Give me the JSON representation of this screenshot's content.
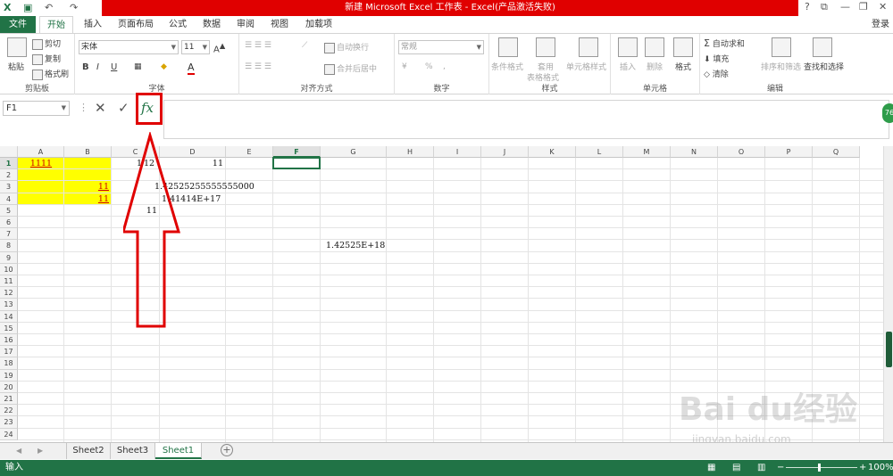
{
  "titlebar": {
    "title": "新建 Microsoft Excel 工作表 - Excel(产品激活失败)",
    "help": "?",
    "restore_ribbon": "⧉",
    "minimize": "—",
    "maximize": "❐",
    "close": "✕",
    "login": "登录"
  },
  "tabs": {
    "file": "文件",
    "home": "开始",
    "insert": "插入",
    "layout": "页面布局",
    "formulas": "公式",
    "data": "数据",
    "review": "审阅",
    "view": "视图",
    "addins": "加载项"
  },
  "ribbon": {
    "clipboard": {
      "label": "剪贴板",
      "paste": "粘贴",
      "cut": "剪切",
      "copy": "复制",
      "format_painter": "格式刷"
    },
    "font": {
      "label": "字体",
      "font_name": "宋体",
      "font_size": "11",
      "bold": "B",
      "italic": "I",
      "underline": "U",
      "color_a": "A"
    },
    "alignment": {
      "label": "对齐方式",
      "wrap": "自动换行",
      "merge": "合并后居中"
    },
    "number": {
      "label": "数字",
      "format": "常规",
      "percent": "%",
      "comma": ","
    },
    "styles": {
      "label": "样式",
      "conditional": "条件格式",
      "table": "套用",
      "table2": "表格格式",
      "cell_styles": "单元格样式"
    },
    "cells": {
      "label": "单元格",
      "insert": "插入",
      "delete": "删除",
      "format": "格式"
    },
    "editing": {
      "label": "编辑",
      "autosum": "自动求和",
      "fill": "填充",
      "clear": "清除",
      "sort": "排序和筛选",
      "find": "查找和选择"
    }
  },
  "formula_bar": {
    "name_box": "F1",
    "fx": "fx",
    "cancel": "✕",
    "enter": "✓",
    "badge": "76"
  },
  "columns": [
    "A",
    "B",
    "C",
    "D",
    "E",
    "F",
    "G",
    "H",
    "I",
    "J",
    "K",
    "L",
    "M",
    "N",
    "O",
    "P",
    "Q"
  ],
  "rows": [
    "1",
    "2",
    "3",
    "4",
    "5",
    "6",
    "7",
    "8",
    "9",
    "10",
    "11",
    "12",
    "13",
    "14",
    "15",
    "16",
    "17",
    "18",
    "19",
    "20",
    "21",
    "22",
    "23",
    "24"
  ],
  "cells": {
    "A1": "1111",
    "C1": "1",
    "C1b": "12",
    "D1": "11",
    "B3": "11",
    "C3": "1.42525255555555000",
    "B4": "11",
    "C4": "1.41414E+17",
    "C5": "11",
    "G8": "1.42525E+18"
  },
  "sheets": {
    "tab1": "Sheet2",
    "tab2": "Sheet3",
    "tab3": "Sheet1",
    "add": "+",
    "prev": "◀",
    "next": "▶"
  },
  "status": {
    "mode": "输入",
    "zoom": "100%",
    "minus": "−",
    "plus": "+"
  },
  "watermark": {
    "brand": "Bai du经验",
    "url": "jingyan.baidu.com"
  },
  "colors": {
    "excel_green": "#217346",
    "title_red": "#e00000",
    "highlight_yellow": "#ffff00"
  }
}
